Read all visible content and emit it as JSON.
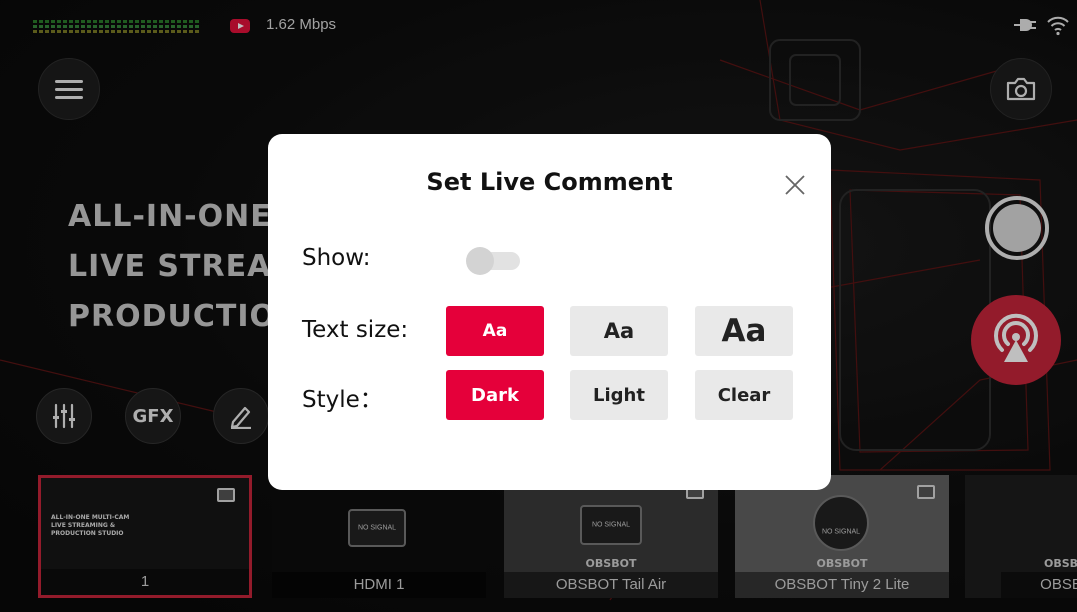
{
  "status_bar": {
    "bitrate": "1.62 Mbps",
    "platform_icon": "youtube-icon",
    "power_icon": "plug-icon",
    "signal_icon": "wifi-icon"
  },
  "hero": {
    "line1": "ALL-IN-ONE",
    "line2": "LIVE STREAM",
    "line3": "PRODUCTIO"
  },
  "tools": {
    "gfx_label": "GFX"
  },
  "scenes": [
    {
      "label": "1",
      "thumb_lines": [
        "ALL-IN-ONE MULTI-CAM",
        "LIVE STREAMING &",
        "PRODUCTION STUDIO"
      ]
    },
    {
      "label": "HDMI 1",
      "thumb_text": "NO SIGNAL"
    },
    {
      "label": "OBSBOT Tail Air",
      "thumb_text": "NO SIGNAL",
      "brand": "OBSBOT"
    },
    {
      "label": "OBSBOT Tiny 2 Lite",
      "thumb_text": "NO SIGNAL",
      "brand": "OBSBOT"
    },
    {
      "label": "OBSB",
      "brand": "OBSB"
    }
  ],
  "dialog": {
    "title": "Set Live Comment",
    "show_label": "Show:",
    "show_enabled": false,
    "text_size_label": "Text size:",
    "text_size_options": [
      "Aa",
      "Aa",
      "Aa"
    ],
    "text_size_selected": 0,
    "style_label": "Style：",
    "style_options": [
      "Dark",
      "Light",
      "Clear"
    ],
    "style_selected": "Dark"
  },
  "colors": {
    "accent": "#e5003a",
    "live_button": "#c4243a",
    "option_bg": "#e9e9e9",
    "dialog_bg": "#ffffff"
  }
}
